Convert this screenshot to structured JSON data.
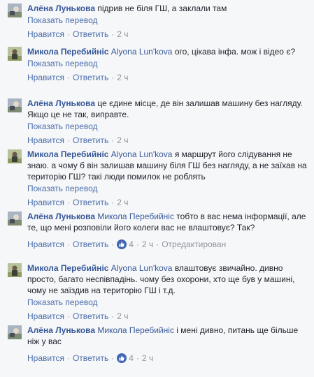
{
  "labels": {
    "translate": "Показать перевод",
    "like": "Нравится",
    "reply": "Ответить",
    "dot": "·",
    "edited": "Отредактирован"
  },
  "comments": [
    {
      "author": "Алёна Лунькова",
      "mention": "",
      "text": "підрив не біля ГШ, а заклали там",
      "time": "2 ч",
      "likes": ""
    },
    {
      "author": "Микола Перебийніс",
      "mention": "Alyona Lun'kova",
      "text": "ого, цікава інфа. мож і відео є?",
      "time": "2 ч",
      "likes": ""
    },
    {
      "author": "Алёна Лунькова",
      "mention": "",
      "text": "це єдине місце, де він залишав машину без нагляду. Якщо це не так, виправте.",
      "time": "2 ч",
      "likes": ""
    },
    {
      "author": "Микола Перебийніс",
      "mention": "Alyona Lun'kova",
      "text": "я маршрут його слідування не знаю. а чому б він залишав машину біля ГШ без нагляду, а не заїхав на територію ГШ? такі люди помилок не роблять",
      "time": "2 ч",
      "likes": ""
    },
    {
      "author": "Алёна Лунькова",
      "mention": "Микола Перебийніс",
      "text": "тобто в вас нема інформації, але те, що мені розповіли його колеги вас не влаштовує? Так?",
      "time": "2 ч",
      "likes": "4",
      "edited": true
    },
    {
      "author": "Микола Перебийніс",
      "mention": "Alyona Lun'kova",
      "text": "влаштовує звичайно. дивно просто, багато неспівпадінь. чому без охорони, хто ще був у машині, чому не заїздив на територію ГШ і т.д.",
      "time": "2 ч",
      "likes": ""
    },
    {
      "author": "Алёна Лунькова",
      "mention": "Микола Перебийніс",
      "text": "і мені дивно, питань ще більше ніж у вас",
      "time": "2 ч",
      "likes": "4"
    }
  ]
}
